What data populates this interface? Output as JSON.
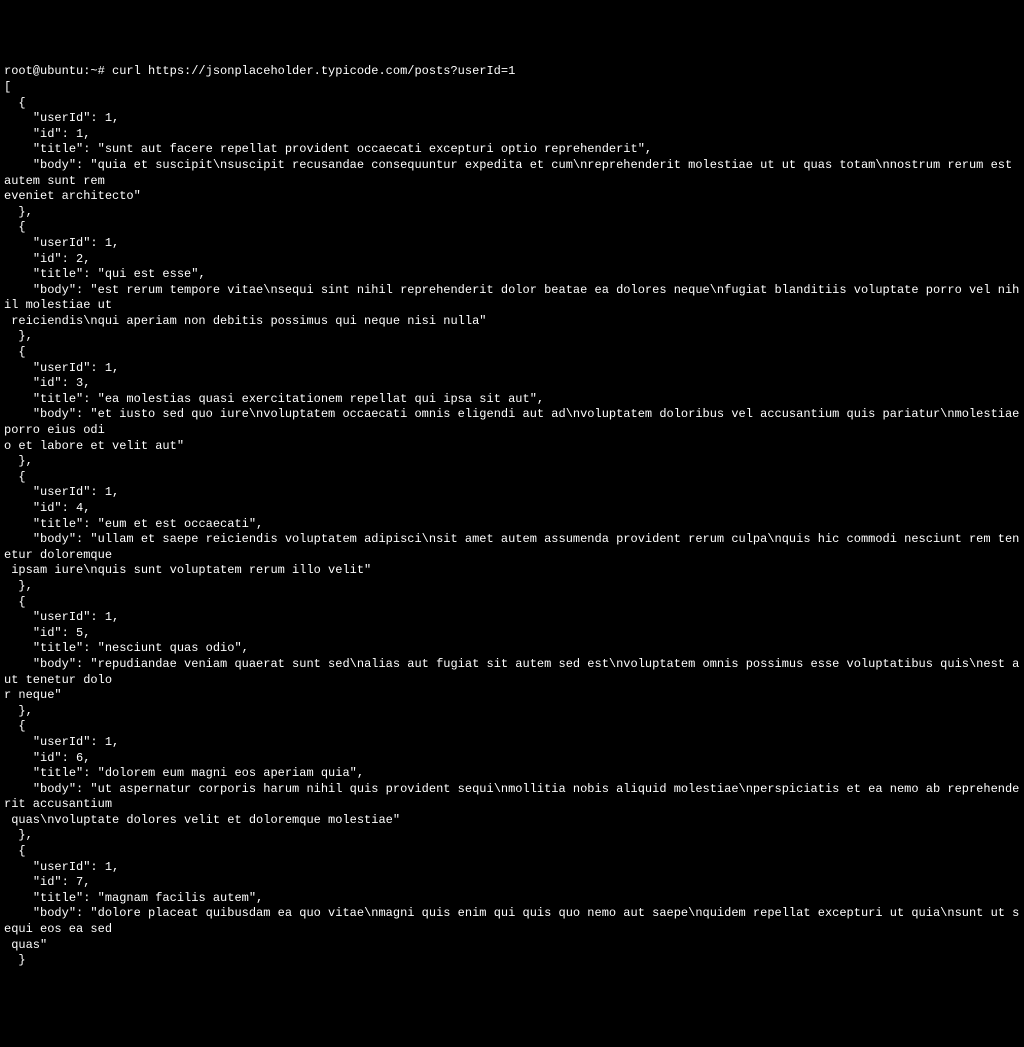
{
  "prompt": {
    "user": "root",
    "host": "ubuntu",
    "path": "~",
    "symbol": "#",
    "command": "curl https://jsonplaceholder.typicode.com/posts?userId=1"
  },
  "json_posts": [
    {
      "userId": 1,
      "id": 1,
      "title": "sunt aut facere repellat provident occaecati excepturi optio reprehenderit",
      "body": "quia et suscipit\\nsuscipit recusandae consequuntur expedita et cum\\nreprehenderit molestiae ut ut quas totam\\nnostrum rerum est autem sunt rem eveniet architecto"
    },
    {
      "userId": 1,
      "id": 2,
      "title": "qui est esse",
      "body": "est rerum tempore vitae\\nsequi sint nihil reprehenderit dolor beatae ea dolores neque\\nfugiat blanditiis voluptate porro vel nihil molestiae ut reiciendis\\nqui aperiam non debitis possimus qui neque nisi nulla"
    },
    {
      "userId": 1,
      "id": 3,
      "title": "ea molestias quasi exercitationem repellat qui ipsa sit aut",
      "body": "et iusto sed quo iure\\nvoluptatem occaecati omnis eligendi aut ad\\nvoluptatem doloribus vel accusantium quis pariatur\\nmolestiae porro eius odio et labore et velit aut"
    },
    {
      "userId": 1,
      "id": 4,
      "title": "eum et est occaecati",
      "body": "ullam et saepe reiciendis voluptatem adipisci\\nsit amet autem assumenda provident rerum culpa\\nquis hic commodi nesciunt rem tenetur doloremque ipsam iure\\nquis sunt voluptatem rerum illo velit"
    },
    {
      "userId": 1,
      "id": 5,
      "title": "nesciunt quas odio",
      "body": "repudiandae veniam quaerat sunt sed\\nalias aut fugiat sit autem sed est\\nvoluptatem omnis possimus esse voluptatibus quis\\nest aut tenetur dolor neque"
    },
    {
      "userId": 1,
      "id": 6,
      "title": "dolorem eum magni eos aperiam quia",
      "body": "ut aspernatur corporis harum nihil quis provident sequi\\nmollitia nobis aliquid molestiae\\nperspiciatis et ea nemo ab reprehenderit accusantium quas\\nvoluptate dolores velit et doloremque molestiae"
    },
    {
      "userId": 1,
      "id": 7,
      "title": "magnam facilis autem",
      "body": "dolore placeat quibusdam ea quo vitae\\nmagni quis enim qui quis quo nemo aut saepe\\nquidem repellat excepturi ut quia\\nsunt ut sequi eos ea sed quas"
    }
  ],
  "columns": 156
}
